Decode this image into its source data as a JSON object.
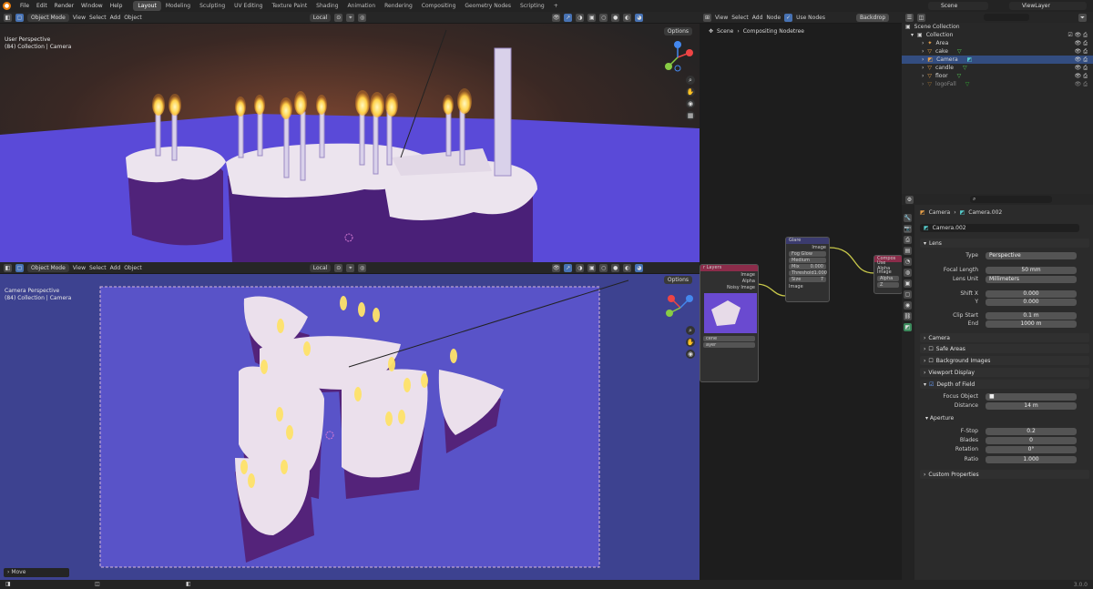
{
  "topbar": {
    "menus": [
      "File",
      "Edit",
      "Render",
      "Window",
      "Help"
    ],
    "workspaces": [
      "Layout",
      "Modeling",
      "Sculpting",
      "UV Editing",
      "Texture Paint",
      "Shading",
      "Animation",
      "Rendering",
      "Compositing",
      "Geometry Nodes",
      "Scripting",
      "+"
    ],
    "active_workspace": "Layout",
    "scene": "Scene",
    "view_layer": "ViewLayer"
  },
  "viewport_top": {
    "mode": "Object Mode",
    "menus": [
      "View",
      "Select",
      "Add",
      "Object"
    ],
    "orientation": "Local",
    "options": "Options",
    "info_line1": "User Perspective",
    "info_line2": "(84) Collection | Camera"
  },
  "viewport_bottom": {
    "mode": "Object Mode",
    "menus": [
      "View",
      "Select",
      "Add",
      "Object"
    ],
    "orientation": "Local",
    "options": "Options",
    "info_line1": "Camera Perspective",
    "info_line2": "(84) Collection | Camera",
    "last_op": "Move"
  },
  "compositor": {
    "menus": [
      "View",
      "Select",
      "Add",
      "Node"
    ],
    "use_nodes": "Use Nodes",
    "backdrop": "Backdrop",
    "breadcrumb_scene": "Scene",
    "breadcrumb_tree": "Compositing Nodetree",
    "render_layers_node": {
      "title": "r Layers",
      "outputs": [
        "Image",
        "Alpha",
        "Noisy Image"
      ],
      "scene": "cene",
      "layer": "ayer"
    },
    "glare_node": {
      "title": "Glare",
      "output": "Image",
      "type": "Fog Glow",
      "quality": "Medium",
      "mix_label": "Mix",
      "mix": "0.000",
      "threshold_label": "Threshold",
      "threshold": "1.000",
      "size_label": "Size",
      "size": "7",
      "input": "Image"
    },
    "composite_node": {
      "title": "Compos",
      "use_alpha": "Use Alpha",
      "inputs": [
        "Image",
        "Alpha",
        "Z"
      ]
    }
  },
  "outliner": {
    "root": "Scene Collection",
    "collection": "Collection",
    "items": [
      {
        "name": "Area"
      },
      {
        "name": "cake"
      },
      {
        "name": "Camera",
        "selected": true
      },
      {
        "name": "candle"
      },
      {
        "name": "floor"
      },
      {
        "name": "logoFall"
      }
    ]
  },
  "properties": {
    "breadcrumb_object": "Camera",
    "breadcrumb_data": "Camera.002",
    "data_name": "Camera.002",
    "lens_panel": "Lens",
    "type_label": "Type",
    "type_value": "Perspective",
    "focal_label": "Focal Length",
    "focal_value": "50 mm",
    "lens_unit_label": "Lens Unit",
    "lens_unit_value": "Millimeters",
    "shift_x_label": "Shift X",
    "shift_x_value": "0.000",
    "shift_y_label": "Y",
    "shift_y_value": "0.000",
    "clip_start_label": "Clip Start",
    "clip_start_value": "0.1 m",
    "clip_end_label": "End",
    "clip_end_value": "1000 m",
    "panels": [
      "Camera",
      "Safe Areas",
      "Background Images",
      "Viewport Display"
    ],
    "dof_panel": "Depth of Field",
    "focus_object_label": "Focus Object",
    "distance_label": "Distance",
    "distance_value": "14 m",
    "aperture_panel": "Aperture",
    "fstop_label": "F-Stop",
    "fstop_value": "0.2",
    "blades_label": "Blades",
    "blades_value": "0",
    "rotation_label": "Rotation",
    "rotation_value": "0°",
    "ratio_label": "Ratio",
    "ratio_value": "1.000",
    "custom_props": "Custom Properties"
  },
  "status": {
    "version": "3.0.0"
  }
}
